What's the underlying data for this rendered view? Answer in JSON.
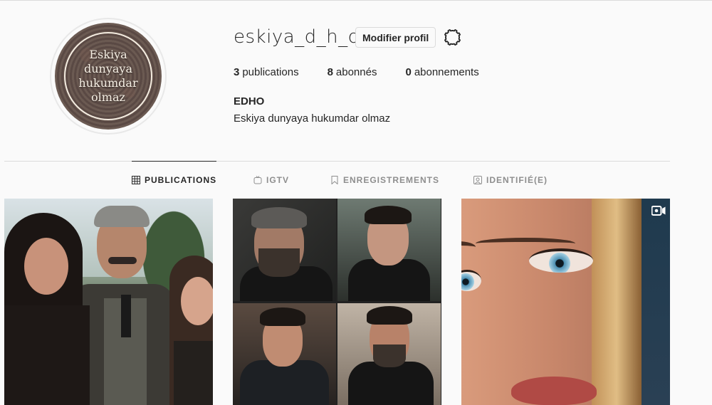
{
  "profile": {
    "username": "eskiya_d_h_o",
    "edit_label": "Modifier profil",
    "avatar_text": "Eskiya dunyaya hukumdar olmaz",
    "stats": {
      "posts_count": "3",
      "posts_label": "publications",
      "followers_count": "8",
      "followers_label": "abonnés",
      "following_count": "0",
      "following_label": "abonnements"
    },
    "full_name": "EDHO",
    "bio": "Eskiya dunyaya hukumdar olmaz"
  },
  "tabs": [
    {
      "label": "PUBLICATIONS",
      "icon": "grid-icon",
      "active": true
    },
    {
      "label": "IGTV",
      "icon": "igtv-icon",
      "active": false
    },
    {
      "label": "ENREGISTREMENTS",
      "icon": "bookmark-icon",
      "active": false
    },
    {
      "label": "IDENTIFIÉ(E)",
      "icon": "tagged-icon",
      "active": false
    }
  ],
  "posts": [
    {
      "description": "three-people-photo"
    },
    {
      "description": "four-men-collage"
    },
    {
      "description": "woman-face-closeup",
      "badge": "igtv-icon"
    }
  ],
  "colors": {
    "text": "#262626",
    "muted": "#8e8e8e",
    "border": "#dbdbdb",
    "background": "#fafafa"
  }
}
